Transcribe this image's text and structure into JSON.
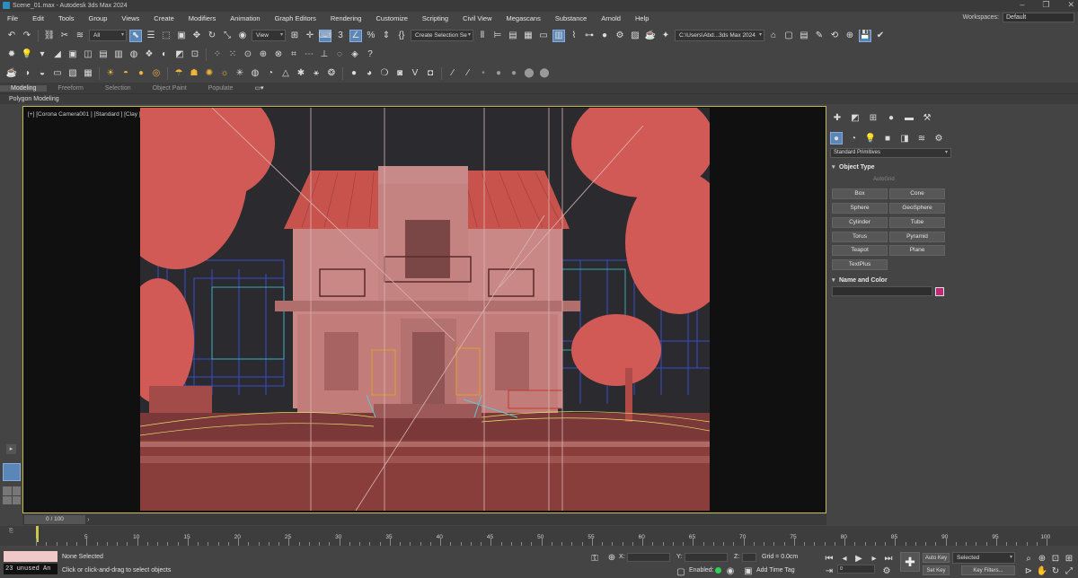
{
  "title_bar": {
    "title": "Scene_01.max - Autodesk 3ds Max 2024"
  },
  "menu": {
    "items": [
      "File",
      "Edit",
      "Tools",
      "Group",
      "Views",
      "Create",
      "Modifiers",
      "Animation",
      "Graph Editors",
      "Rendering",
      "Customize",
      "Scripting",
      "Civil View",
      "Megascans",
      "Substance",
      "Arnold",
      "Help"
    ],
    "workspaces_label": "Workspaces:",
    "workspaces_value": "Default"
  },
  "toolbar": {
    "selection_filter": "All",
    "ref_coord": "View",
    "named_selection": "Create Selection Se",
    "project_path": "C:\\Users\\Abd...3ds Max 2024"
  },
  "ribbon": {
    "tabs": [
      "Modeling",
      "Freeform",
      "Selection",
      "Object Paint",
      "Populate"
    ],
    "active_tab": "Modeling",
    "sub_label": "Polygon Modeling"
  },
  "viewport": {
    "label": "[+] [Corona Camera001 ] [Standard ] [Clay ]"
  },
  "command_panel": {
    "category_dropdown": "Standard Primitives",
    "object_type_header": "Object Type",
    "autogrid_label": "AutoGrid",
    "object_buttons": [
      "Box",
      "Cone",
      "Sphere",
      "GeoSphere",
      "Cylinder",
      "Tube",
      "Torus",
      "Pyramid",
      "Teapot",
      "Plane",
      "TextPlus"
    ],
    "name_color_header": "Name and Color",
    "swatch_color": "#c02a74"
  },
  "timeline": {
    "frame_display": "0 / 100",
    "ticks": [
      "5",
      "10",
      "15",
      "20",
      "25",
      "30",
      "35",
      "40",
      "45",
      "50",
      "55",
      "60",
      "65",
      "70",
      "75",
      "80",
      "85",
      "90",
      "95",
      "100"
    ]
  },
  "status_bar": {
    "maxscript_unused": "23 unused An",
    "selection_status": "None Selected",
    "prompt": "Click or click-and-drag to select objects",
    "x_label": "X:",
    "y_label": "Y:",
    "z_label": "Z:",
    "grid_label": "Grid = 0.0cm",
    "enabled_label": "Enabled:",
    "add_time_tag": "Add Time Tag",
    "auto_key": "Auto Key",
    "set_key": "Set Key",
    "selected_dropdown": "Selected",
    "key_filters": "Key Filters...",
    "frame_value": "0"
  }
}
